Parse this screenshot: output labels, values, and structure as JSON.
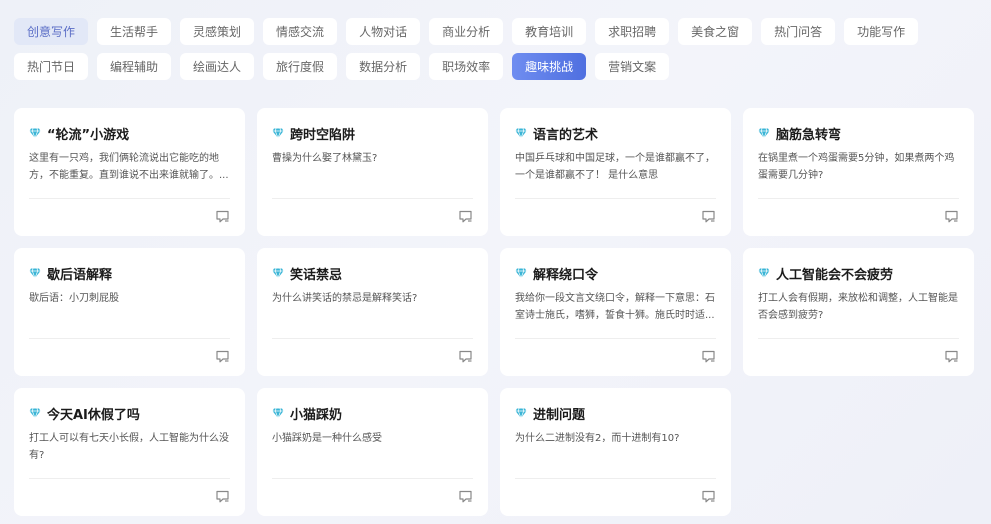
{
  "tags": [
    "创意写作",
    "生活帮手",
    "灵感策划",
    "情感交流",
    "人物对话",
    "商业分析",
    "教育培训",
    "求职招聘",
    "美食之窗",
    "热门问答",
    "功能写作",
    "热门节日",
    "编程辅助",
    "绘画达人",
    "旅行度假",
    "数据分析",
    "职场效率",
    "趣味挑战",
    "营销文案"
  ],
  "active_tag": "趣味挑战",
  "colors": {
    "accent": "#5b7be8",
    "diamond": "#39b5d6"
  },
  "icons": {
    "card_title": "diamond-icon",
    "card_action": "chat-icon"
  },
  "cards": [
    {
      "title": "“轮流”小游戏",
      "desc": "这里有一只鸡，我们俩轮流说出它能吃的地方，不能重复。直到谁说不出来谁就输了。..."
    },
    {
      "title": "跨时空陷阱",
      "desc": "曹操为什么娶了林黛玉?"
    },
    {
      "title": "语言的艺术",
      "desc": "中国乒乓球和中国足球，一个是谁都赢不了，一个是谁都赢不了！ 是什么意思"
    },
    {
      "title": "脑筋急转弯",
      "desc": "在锅里煮一个鸡蛋需要5分钟，如果煮两个鸡蛋需要几分钟?"
    },
    {
      "title": "歇后语解释",
      "desc": "歇后语：小刀刺屁股"
    },
    {
      "title": "笑话禁忌",
      "desc": "为什么讲笑话的禁忌是解释笑话?"
    },
    {
      "title": "解释绕口令",
      "desc": "我给你一段文言文绕口令，解释一下意思：石室诗士施氏，嗜狮，誓食十狮。施氏时时适..."
    },
    {
      "title": "人工智能会不会疲劳",
      "desc": "打工人会有假期，来放松和调整，人工智能是否会感到疲劳?"
    },
    {
      "title": "今天AI休假了吗",
      "desc": "打工人可以有七天小长假，人工智能为什么没有?"
    },
    {
      "title": "小猫踩奶",
      "desc": "小猫踩奶是一种什么感受"
    },
    {
      "title": "进制问题",
      "desc": "为什么二进制没有2，而十进制有10?"
    }
  ]
}
